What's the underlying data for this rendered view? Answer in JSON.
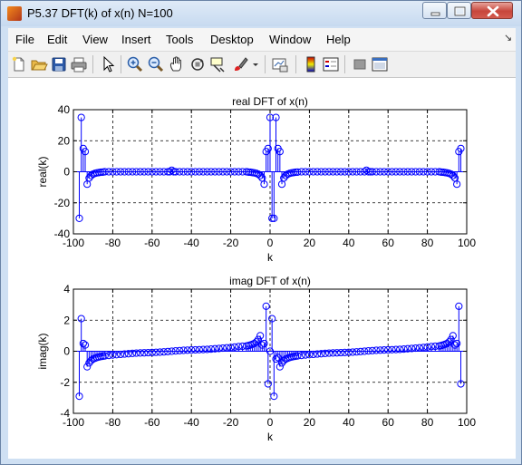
{
  "window": {
    "title": "P5.37 DFT(k) of x(n) N=100"
  },
  "menu": [
    "File",
    "Edit",
    "View",
    "Insert",
    "Tools",
    "Desktop",
    "Window",
    "Help"
  ],
  "menu_overflow": "↘",
  "toolbar": {
    "icons": [
      "new-file-icon",
      "open-file-icon",
      "save-icon",
      "print-icon",
      "select-arrow-icon",
      "zoom-in-icon",
      "zoom-out-icon",
      "pan-icon",
      "rotate-3d-icon",
      "data-cursor-icon",
      "brush-icon",
      "brush-menu-icon",
      "link-plot-icon",
      "colorbar-icon",
      "legend-icon",
      "hide-plot-tools-icon",
      "show-plot-tools-icon"
    ]
  },
  "colors": {
    "series": "#0000ff",
    "grid": "#000000",
    "titlebar": "#cfe0f3"
  },
  "chart_data": [
    {
      "type": "stem",
      "title": "real DFT of x(n)",
      "xlabel": "k",
      "ylabel": "real(k)",
      "xlim": [
        -100,
        100
      ],
      "ylim": [
        -40,
        40
      ],
      "xticks": [
        "-100",
        "-80",
        "-60",
        "-40",
        "-20",
        "0",
        "20",
        "40",
        "60",
        "80",
        "100"
      ],
      "yticks": [
        "40",
        "20",
        "0",
        "-20",
        "-40"
      ],
      "grid": true,
      "x": [
        -97,
        -96,
        -95,
        -94,
        -93,
        -92,
        -91,
        -90,
        -89,
        -88,
        -87,
        -86,
        -85,
        -84,
        -82,
        -80,
        -78,
        -76,
        -74,
        -72,
        -70,
        -68,
        -66,
        -64,
        -62,
        -60,
        -58,
        -56,
        -54,
        -52,
        -51,
        -50,
        -49,
        -48,
        -46,
        -44,
        -42,
        -40,
        -38,
        -36,
        -34,
        -32,
        -30,
        -28,
        -26,
        -24,
        -22,
        -20,
        -18,
        -16,
        -14,
        -12,
        -11,
        -10,
        -9,
        -8,
        -7,
        -6,
        -5,
        -4,
        -3,
        -2,
        -1,
        0,
        1,
        2,
        3,
        4,
        5,
        6,
        7,
        8,
        9,
        10,
        11,
        12,
        13,
        14,
        16,
        18,
        20,
        22,
        24,
        26,
        28,
        30,
        32,
        34,
        36,
        38,
        40,
        42,
        44,
        46,
        48,
        49,
        50,
        51,
        52,
        54,
        56,
        58,
        60,
        62,
        64,
        66,
        68,
        70,
        72,
        74,
        76,
        78,
        80,
        82,
        84,
        86,
        87,
        88,
        89,
        90,
        91,
        92,
        93,
        94,
        95,
        96,
        97
      ],
      "y": [
        -30,
        35,
        15,
        13,
        -8,
        -4,
        -2.5,
        -1.5,
        -1,
        -0.7,
        -0.5,
        -0.3,
        -0.2,
        0,
        0,
        0,
        0,
        0,
        0,
        0,
        0,
        0,
        0,
        0,
        0,
        0,
        0,
        0,
        0,
        0,
        0,
        1,
        0,
        0,
        0,
        0,
        0,
        0,
        0,
        0,
        0,
        0,
        0,
        0,
        0,
        0,
        0,
        0,
        0,
        0,
        0,
        0,
        -0.2,
        -0.3,
        -0.5,
        -0.7,
        -1,
        -1.5,
        -2.5,
        -4,
        -8,
        13,
        15,
        35,
        -30,
        -30,
        35,
        15,
        13,
        -8,
        -4,
        -2.5,
        -1.5,
        -1,
        -0.7,
        -0.5,
        -0.3,
        -0.2,
        0,
        0,
        0,
        0,
        0,
        0,
        0,
        0,
        0,
        0,
        0,
        0,
        0,
        0,
        0,
        0,
        0,
        1,
        0,
        0,
        0,
        0,
        0,
        0,
        0,
        0,
        0,
        0,
        0,
        0,
        0,
        0,
        0,
        0,
        0,
        0,
        0,
        0,
        -0.2,
        -0.3,
        -0.5,
        -0.7,
        -1,
        -1.5,
        -2.5,
        -4,
        -8,
        13,
        15,
        35,
        -30
      ]
    },
    {
      "type": "stem",
      "title": "imag DFT of x(n)",
      "xlabel": "k",
      "ylabel": "imag(k)",
      "xlim": [
        -100,
        100
      ],
      "ylim": [
        -4,
        4
      ],
      "xticks": [
        "-100",
        "-80",
        "-60",
        "-40",
        "-20",
        "0",
        "20",
        "40",
        "60",
        "80",
        "100"
      ],
      "yticks": [
        "4",
        "2",
        "0",
        "-2",
        "-4"
      ],
      "grid": true,
      "x": [
        -97,
        -96,
        -95,
        -94,
        -93,
        -92,
        -91,
        -90,
        -89,
        -88,
        -87,
        -86,
        -85,
        -84,
        -82,
        -80,
        -78,
        -76,
        -74,
        -72,
        -70,
        -68,
        -66,
        -64,
        -62,
        -60,
        -58,
        -56,
        -54,
        -52,
        -50,
        -48,
        -46,
        -44,
        -42,
        -40,
        -38,
        -36,
        -34,
        -32,
        -30,
        -28,
        -26,
        -24,
        -22,
        -20,
        -18,
        -16,
        -14,
        -12,
        -11,
        -10,
        -9,
        -8,
        -7,
        -6,
        -5,
        -4,
        -3,
        -2,
        -1,
        0,
        1,
        2,
        3,
        4,
        5,
        6,
        7,
        8,
        9,
        10,
        11,
        12,
        13,
        14,
        16,
        18,
        20,
        22,
        24,
        26,
        28,
        30,
        32,
        34,
        36,
        38,
        40,
        42,
        44,
        46,
        48,
        50,
        52,
        54,
        56,
        58,
        60,
        62,
        64,
        66,
        68,
        70,
        72,
        74,
        76,
        78,
        80,
        82,
        84,
        86,
        87,
        88,
        89,
        90,
        91,
        92,
        93,
        94,
        95,
        96,
        97
      ],
      "y": [
        -2.9,
        2.1,
        0.5,
        0.4,
        -1,
        -0.75,
        -0.6,
        -0.5,
        -0.45,
        -0.4,
        -0.37,
        -0.34,
        -0.32,
        -0.3,
        -0.27,
        -0.24,
        -0.22,
        -0.2,
        -0.18,
        -0.16,
        -0.14,
        -0.12,
        -0.11,
        -0.1,
        -0.09,
        -0.08,
        -0.07,
        -0.06,
        -0.04,
        -0.02,
        0,
        0.02,
        0.04,
        0.06,
        0.07,
        0.08,
        0.09,
        0.1,
        0.11,
        0.12,
        0.14,
        0.16,
        0.18,
        0.2,
        0.22,
        0.24,
        0.27,
        0.3,
        0.32,
        0.34,
        0.37,
        0.4,
        0.45,
        0.5,
        0.6,
        0.75,
        1,
        0.4,
        0.5,
        2.9,
        -2.1,
        0,
        2.1,
        -2.9,
        -0.5,
        -0.4,
        -1,
        -0.75,
        -0.6,
        -0.5,
        -0.45,
        -0.4,
        -0.37,
        -0.34,
        -0.32,
        -0.3,
        -0.27,
        -0.24,
        -0.22,
        -0.2,
        -0.18,
        -0.16,
        -0.14,
        -0.12,
        -0.11,
        -0.1,
        -0.09,
        -0.08,
        -0.07,
        -0.06,
        -0.04,
        -0.02,
        0,
        0.02,
        0.04,
        0.06,
        0.07,
        0.08,
        0.09,
        0.1,
        0.11,
        0.12,
        0.14,
        0.16,
        0.18,
        0.2,
        0.22,
        0.24,
        0.27,
        0.3,
        0.32,
        0.34,
        0.37,
        0.4,
        0.45,
        0.5,
        0.6,
        0.75,
        1,
        0.4,
        0.5,
        2.9,
        -2.1
      ]
    }
  ]
}
